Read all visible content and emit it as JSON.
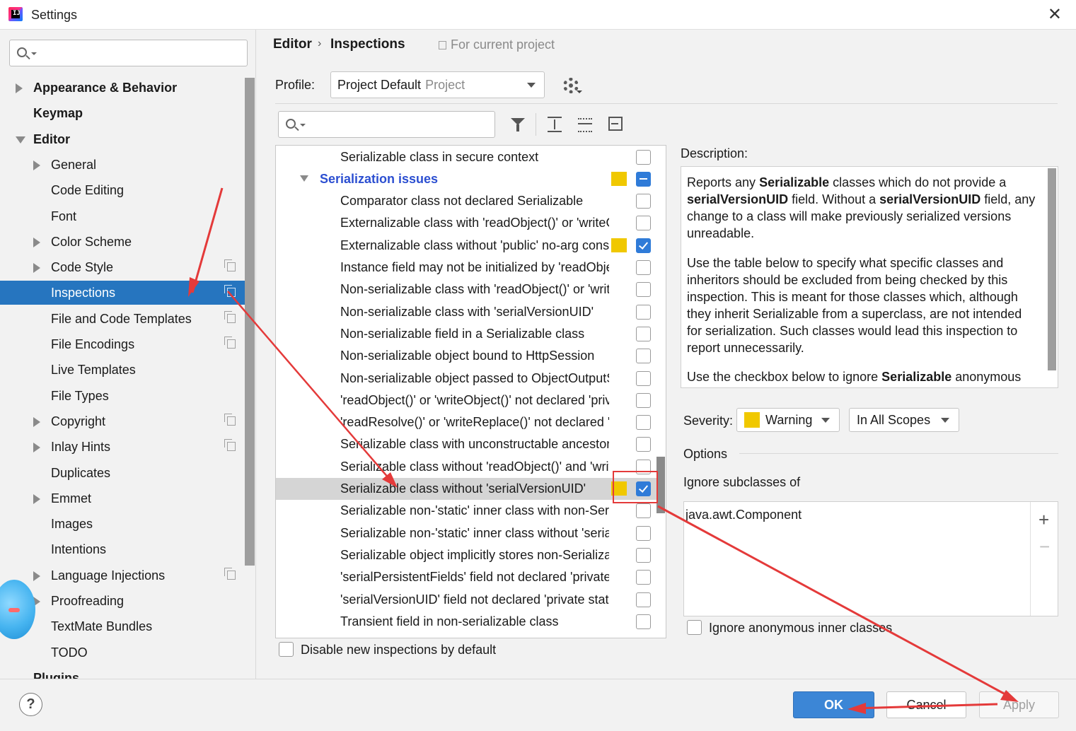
{
  "window": {
    "title": "Settings",
    "close_icon": "close-icon"
  },
  "sidebar": {
    "search_placeholder": "",
    "items": [
      {
        "label": "Appearance & Behavior",
        "bold": true,
        "expand": "collapsed",
        "level": 0
      },
      {
        "label": "Keymap",
        "bold": true,
        "expand": "none",
        "level": 0
      },
      {
        "label": "Editor",
        "bold": true,
        "expand": "expanded",
        "level": 0
      },
      {
        "label": "General",
        "expand": "collapsed",
        "level": 1
      },
      {
        "label": "Code Editing",
        "expand": "none",
        "level": 1
      },
      {
        "label": "Font",
        "expand": "none",
        "level": 1
      },
      {
        "label": "Color Scheme",
        "expand": "collapsed",
        "level": 1
      },
      {
        "label": "Code Style",
        "expand": "collapsed",
        "level": 1,
        "project_icon": true
      },
      {
        "label": "Inspections",
        "expand": "none",
        "level": 1,
        "project_icon": true,
        "selected": true
      },
      {
        "label": "File and Code Templates",
        "expand": "none",
        "level": 1,
        "project_icon": true
      },
      {
        "label": "File Encodings",
        "expand": "none",
        "level": 1,
        "project_icon": true
      },
      {
        "label": "Live Templates",
        "expand": "none",
        "level": 1
      },
      {
        "label": "File Types",
        "expand": "none",
        "level": 1
      },
      {
        "label": "Copyright",
        "expand": "collapsed",
        "level": 1,
        "project_icon": true
      },
      {
        "label": "Inlay Hints",
        "expand": "collapsed",
        "level": 1,
        "project_icon": true
      },
      {
        "label": "Duplicates",
        "expand": "none",
        "level": 1
      },
      {
        "label": "Emmet",
        "expand": "collapsed",
        "level": 1
      },
      {
        "label": "Images",
        "expand": "none",
        "level": 1
      },
      {
        "label": "Intentions",
        "expand": "none",
        "level": 1
      },
      {
        "label": "Language Injections",
        "expand": "collapsed",
        "level": 1,
        "project_icon": true
      },
      {
        "label": "Proofreading",
        "expand": "collapsed",
        "level": 1
      },
      {
        "label": "TextMate Bundles",
        "expand": "none",
        "level": 1
      },
      {
        "label": "TODO",
        "expand": "none",
        "level": 1
      },
      {
        "label": "Plugins",
        "bold": true,
        "expand": "none",
        "level": 0
      }
    ]
  },
  "header": {
    "breadcrumb_1": "Editor",
    "breadcrumb_sep": "›",
    "breadcrumb_2": "Inspections",
    "scope_note": "For current project"
  },
  "profile": {
    "label": "Profile:",
    "value": "Project Default",
    "value_suffix": "Project"
  },
  "inspections": [
    {
      "label": "Serializable class in secure context",
      "checked": "off"
    },
    {
      "label": "Serialization issues",
      "group": true,
      "checked": "partial",
      "warning": true
    },
    {
      "label": "Comparator class not declared Serializable",
      "checked": "off"
    },
    {
      "label": "Externalizable class with 'readObject()' or 'writeObject()'",
      "checked": "off"
    },
    {
      "label": "Externalizable class without 'public' no-arg constructor",
      "checked": "on",
      "warning": true
    },
    {
      "label": "Instance field may not be initialized by 'readObject()'",
      "checked": "off"
    },
    {
      "label": "Non-serializable class with 'readObject()' or 'writeObject()'",
      "checked": "off"
    },
    {
      "label": "Non-serializable class with 'serialVersionUID'",
      "checked": "off"
    },
    {
      "label": "Non-serializable field in a Serializable class",
      "checked": "off"
    },
    {
      "label": "Non-serializable object bound to HttpSession",
      "checked": "off"
    },
    {
      "label": "Non-serializable object passed to ObjectOutputStream",
      "checked": "off"
    },
    {
      "label": "'readObject()' or 'writeObject()' not declared 'private'",
      "checked": "off"
    },
    {
      "label": "'readResolve()' or 'writeReplace()' not declared 'protected'",
      "checked": "off"
    },
    {
      "label": "Serializable class with unconstructable ancestor",
      "checked": "off"
    },
    {
      "label": "Serializable class without 'readObject()' and 'writeObject()'",
      "checked": "off"
    },
    {
      "label": "Serializable class without 'serialVersionUID'",
      "checked": "on",
      "warning": true,
      "selected": true
    },
    {
      "label": "Serializable non-'static' inner class with non-Serializable outer class",
      "checked": "off"
    },
    {
      "label": "Serializable non-'static' inner class without 'serialVersionUID'",
      "checked": "off"
    },
    {
      "label": "Serializable object implicitly stores non-Serializable object",
      "checked": "off"
    },
    {
      "label": "'serialPersistentFields' field not declared 'private static final'",
      "checked": "off"
    },
    {
      "label": "'serialVersionUID' field not declared 'private static final long'",
      "checked": "off"
    },
    {
      "label": "Transient field in non-serializable class",
      "checked": "off"
    }
  ],
  "disable_new": {
    "label": "Disable new inspections by default",
    "checked": false
  },
  "description": {
    "label": "Description:",
    "paragraphs": [
      [
        {
          "t": "Reports any "
        },
        {
          "t": "Serializable",
          "b": true
        },
        {
          "t": " classes which do not provide a "
        },
        {
          "t": "serialVersionUID",
          "b": true
        },
        {
          "t": " field. Without a "
        },
        {
          "t": "serialVersionUID",
          "b": true
        },
        {
          "t": " field, any change to a class will make previously serialized versions unreadable."
        }
      ],
      [
        {
          "t": "Use the table below to specify what specific classes and inheritors should be excluded from being checked by this inspection. This is meant for those classes which, although they inherit Serializable from a superclass, are not intended for serialization. Such classes would lead this inspection to report unnecessarily."
        }
      ],
      [
        {
          "t": "Use the checkbox below to ignore "
        },
        {
          "t": "Serializable",
          "b": true
        },
        {
          "t": " anonymous"
        }
      ]
    ]
  },
  "severity": {
    "label": "Severity:",
    "value": "Warning",
    "color": "#f0c800",
    "scope": "In All Scopes"
  },
  "options": {
    "label": "Options",
    "ignore_label": "Ignore subclasses of",
    "ignore_items": [
      "java.awt.Component"
    ],
    "add_symbol": "+",
    "remove_symbol": "−",
    "anonymous_label": "Ignore anonymous inner classes",
    "anonymous_checked": false
  },
  "footer": {
    "help": "?",
    "ok": "OK",
    "cancel": "Cancel",
    "apply": "Apply"
  },
  "colors": {
    "accent": "#2675bf",
    "warning": "#f0c800",
    "annotation": "#e43a3a",
    "group_text": "#2c4fd1"
  }
}
